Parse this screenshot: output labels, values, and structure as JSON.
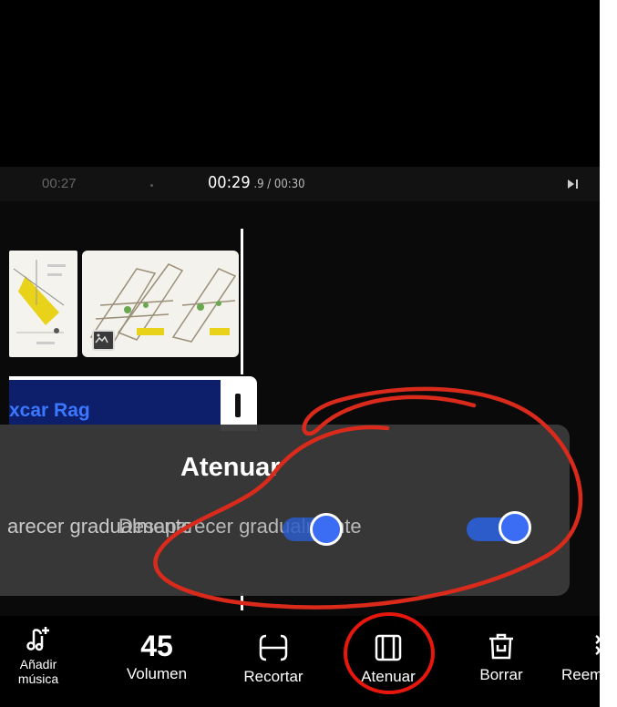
{
  "timebar": {
    "time_left": "00:27",
    "time_current": "00:29",
    "time_fraction": " .9",
    "time_total": " / 00:30"
  },
  "music_track": {
    "title": "xcar Rag"
  },
  "fade_panel": {
    "title": "Atenuar",
    "fade_in_label": "arecer gradualmente",
    "fade_out_label": "Desaparecer gradualmente",
    "fade_in_enabled": true,
    "fade_out_enabled": true
  },
  "toolbar": {
    "add_music_label_1": "Añadir",
    "add_music_label_2": "música",
    "volume_value": "45",
    "volume_label": "Volumen",
    "trim_label": "Recortar",
    "fade_label": "Atenuar",
    "delete_label": "Borrar",
    "replace_label": "Reem"
  },
  "colors": {
    "accent": "#3a6cf4",
    "annotation": "#e0261a",
    "panel_bg": "#393939"
  }
}
